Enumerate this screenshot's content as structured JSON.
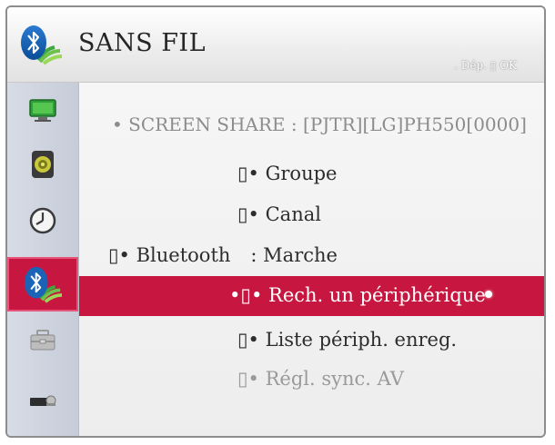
{
  "header": {
    "title": "SANS FIL",
    "hint": ". Dép. ▯ OK"
  },
  "sidebar": {
    "items": [
      {
        "icon": "monitor-icon"
      },
      {
        "icon": "speaker-icon"
      },
      {
        "icon": "clock-icon"
      },
      {
        "icon": "bluetooth-wireless-icon",
        "active": true
      },
      {
        "icon": "toolbox-icon"
      },
      {
        "icon": "input-device-icon"
      }
    ]
  },
  "menu": {
    "screen_share": "• SCREEN SHARE : [PJTR][LG]PH550[0000]",
    "groupe": "▯• Groupe",
    "canal": "▯• Canal",
    "bluetooth_label": "▯• Bluetooth",
    "bluetooth_value": ": Marche",
    "search_device": "•▯• Rech. un périphérique",
    "saved_list": "▯• Liste périph. enreg.",
    "av_sync": "▯• Régl. sync. AV"
  },
  "colors": {
    "accent": "#c7163f",
    "sidebar": "#cfd4de",
    "text": "#2d2d2d",
    "dim_text": "#9a9a9a"
  }
}
